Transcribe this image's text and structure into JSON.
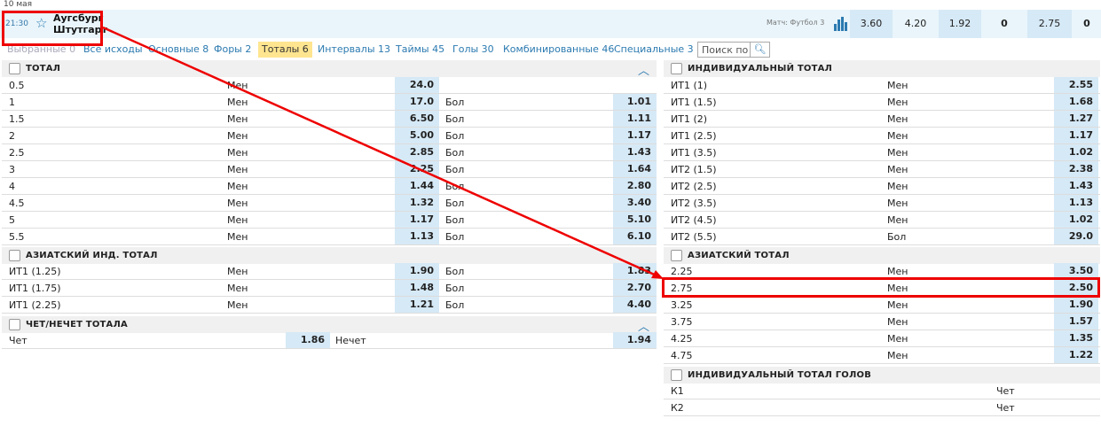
{
  "date": "10 мая",
  "match": {
    "time": "21:30",
    "team1": "Аугсбург",
    "team2": "Штутгарт",
    "label": "Матч: Футбол 3",
    "odds": [
      "3.60",
      "4.20",
      "1.92",
      "0",
      "2.75",
      "0"
    ]
  },
  "tabs": [
    "Выбранные 0",
    "Все исходы",
    "Основные 8",
    "Форы 2",
    "Тоталы 6",
    "Интервалы 13",
    "Таймы 45",
    "Голы 30",
    "Комбинированные 46",
    "Специальные 3"
  ],
  "active_tab": "Тоталы 6",
  "search_placeholder": "Поиск по",
  "left": {
    "total": {
      "title": "ТОТАЛ",
      "rows": [
        {
          "v": "0.5",
          "u": "Мен",
          "uo": "24.0",
          "o": "",
          "oo": ""
        },
        {
          "v": "1",
          "u": "Мен",
          "uo": "17.0",
          "o": "Бол",
          "oo": "1.01"
        },
        {
          "v": "1.5",
          "u": "Мен",
          "uo": "6.50",
          "o": "Бол",
          "oo": "1.11"
        },
        {
          "v": "2",
          "u": "Мен",
          "uo": "5.00",
          "o": "Бол",
          "oo": "1.17"
        },
        {
          "v": "2.5",
          "u": "Мен",
          "uo": "2.85",
          "o": "Бол",
          "oo": "1.43"
        },
        {
          "v": "3",
          "u": "Мен",
          "uo": "2.25",
          "o": "Бол",
          "oo": "1.64"
        },
        {
          "v": "4",
          "u": "Мен",
          "uo": "1.44",
          "o": "Бол",
          "oo": "2.80"
        },
        {
          "v": "4.5",
          "u": "Мен",
          "uo": "1.32",
          "o": "Бол",
          "oo": "3.40"
        },
        {
          "v": "5",
          "u": "Мен",
          "uo": "1.17",
          "o": "Бол",
          "oo": "5.10"
        },
        {
          "v": "5.5",
          "u": "Мен",
          "uo": "1.13",
          "o": "Бол",
          "oo": "6.10"
        }
      ]
    },
    "asian_ind": {
      "title": "АЗИАТСКИЙ ИНД. ТОТАЛ",
      "rows": [
        {
          "v": "ИТ1 (1.25)",
          "u": "Мен",
          "uo": "1.90",
          "o": "Бол",
          "oo": "1.83"
        },
        {
          "v": "ИТ1 (1.75)",
          "u": "Мен",
          "uo": "1.48",
          "o": "Бол",
          "oo": "2.70"
        },
        {
          "v": "ИТ1 (2.25)",
          "u": "Мен",
          "uo": "1.21",
          "o": "Бол",
          "oo": "4.40"
        }
      ]
    },
    "odd_even": {
      "title": "ЧЕТ/НЕЧЕТ ТОТАЛА",
      "even": "Чет",
      "even_odds": "1.86",
      "odd": "Нечет",
      "odd_odds": "1.94"
    }
  },
  "right": {
    "ind_total": {
      "title": "ИНДИВИДУАЛЬНЫЙ ТОТАЛ",
      "rows": [
        {
          "v": "ИТ1 (1)",
          "u": "Мен",
          "o": "2.55"
        },
        {
          "v": "ИТ1 (1.5)",
          "u": "Мен",
          "o": "1.68"
        },
        {
          "v": "ИТ1 (2)",
          "u": "Мен",
          "o": "1.27"
        },
        {
          "v": "ИТ1 (2.5)",
          "u": "Мен",
          "o": "1.17"
        },
        {
          "v": "ИТ1 (3.5)",
          "u": "Мен",
          "o": "1.02"
        },
        {
          "v": "ИТ2 (1.5)",
          "u": "Мен",
          "o": "2.38"
        },
        {
          "v": "ИТ2 (2.5)",
          "u": "Мен",
          "o": "1.43"
        },
        {
          "v": "ИТ2 (3.5)",
          "u": "Мен",
          "o": "1.13"
        },
        {
          "v": "ИТ2 (4.5)",
          "u": "Мен",
          "o": "1.02"
        },
        {
          "v": "ИТ2 (5.5)",
          "u": "Бол",
          "o": "29.0"
        }
      ]
    },
    "asian_total": {
      "title": "АЗИАТСКИЙ ТОТАЛ",
      "rows": [
        {
          "v": "2.25",
          "u": "Мен",
          "o": "3.50"
        },
        {
          "v": "2.75",
          "u": "Мен",
          "o": "2.50"
        },
        {
          "v": "3.25",
          "u": "Мен",
          "o": "1.90"
        },
        {
          "v": "3.75",
          "u": "Мен",
          "o": "1.57"
        },
        {
          "v": "4.25",
          "u": "Мен",
          "o": "1.35"
        },
        {
          "v": "4.75",
          "u": "Мен",
          "o": "1.22"
        }
      ]
    },
    "ind_goals": {
      "title": "ИНДИВИДУАЛЬНЫЙ ТОТАЛ ГОЛОВ",
      "rows": [
        {
          "v": "К1",
          "u": "Чет"
        },
        {
          "v": "К2",
          "u": "Чет"
        }
      ]
    }
  },
  "colors": {
    "highlight": "#e00000",
    "odds_bg": "#d6e9f6",
    "link": "#2b7ab0"
  }
}
